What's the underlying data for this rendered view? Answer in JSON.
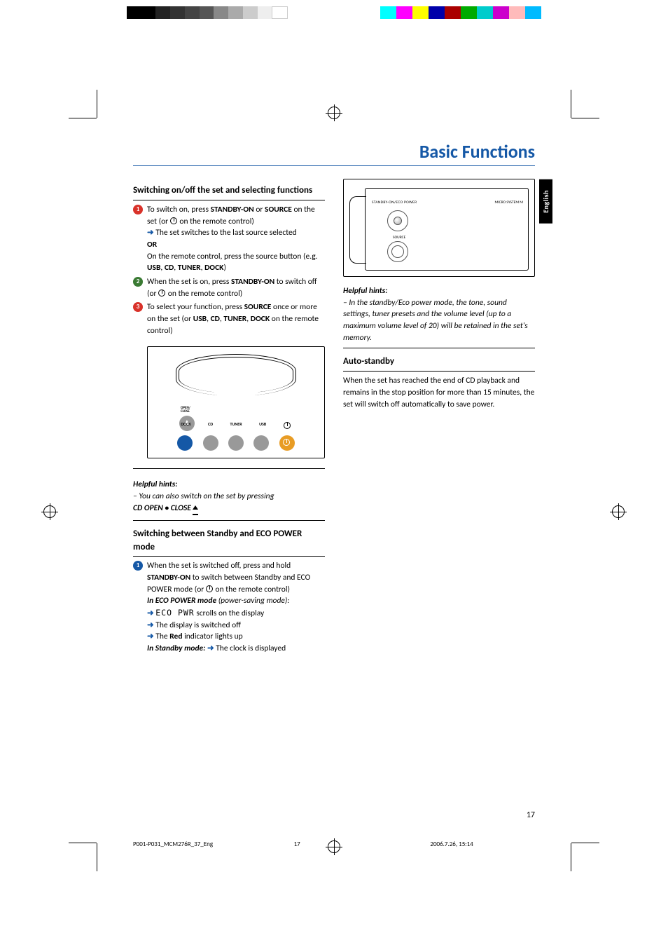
{
  "title": "Basic Functions",
  "lang_tab": "English",
  "page_number": "17",
  "footer": {
    "file": "P001-P031_MCM276R_37_Eng",
    "page": "17",
    "timestamp": "2006.7.26, 15:14"
  },
  "colors": {
    "accent": "#1558a6",
    "numdot_default": "#d9322a"
  },
  "left_col": {
    "s1_head": "Switching on/off the set and selecting functions",
    "step1_a": "To switch on, press ",
    "step1_b": "STANDBY-ON",
    "step1_c": " or ",
    "step1_d": "SOURCE",
    "step1_e": " on the set (or ",
    "step1_f": " on the remote control)",
    "step1_arrow": "➜",
    "step1_res": " The set switches to the last source selected",
    "or": "OR",
    "step1_or_a": "On the remote control, press the source button (e.g. ",
    "step1_or_b": "USB",
    "step1_or_c": ", ",
    "step1_or_d": "CD",
    "step1_or_e": ", ",
    "step1_or_f": "TUNER",
    "step1_or_g": ",  ",
    "step1_or_h": "DOCK",
    "step1_or_i": ")",
    "step2_a": "When the set is on, press ",
    "step2_b": "STANDBY-ON",
    "step2_c": " to switch off (or ",
    "step2_d": " on the remote control)",
    "step3_a": "To select your function, press ",
    "step3_b": "SOURCE",
    "step3_c": " once or more on the set (or ",
    "step3_d": "USB",
    "step3_e": ", ",
    "step3_f": "CD",
    "step3_g": ", ",
    "step3_h": "TUNER",
    "step3_i": ", ",
    "step3_j": "DOCK",
    "step3_k": " on the remote control)",
    "diagram1_labels": [
      "DOCK",
      "CD",
      "TUNER",
      "USB"
    ],
    "diagram1_openclose": "OPEN/\nCLOSE",
    "hint_head": "Helpful hints:",
    "hint1_a": "–  You can also switch on the set by pressing ",
    "hint1_b": "CD OPEN • CLOSE ",
    "s2_head": "Switching between Standby and ECO POWER mode",
    "s2_step1_a": "When the set is switched off, press and hold ",
    "s2_step1_b": "STANDBY-ON",
    "s2_step1_c": " to switch between Standby and ECO POWER mode (or ",
    "s2_step1_d": " on the remote control)",
    "eco_head_a": "In ECO POWER mode ",
    "eco_head_b": "(power-saving mode):",
    "eco_b1_arrow": "➜",
    "eco_b1_lcd": "ECO PWR",
    "eco_b1_txt": "  scrolls on the display",
    "eco_b2_arrow": "➜",
    "eco_b2_txt": " The display is switched off",
    "eco_b3_arrow": "➜",
    "eco_b3_a": " The ",
    "eco_b3_b": "Red",
    "eco_b3_c": " indicator lights up",
    "sb_head": "In Standby mode: ",
    "sb_arrow": "➜",
    "sb_txt": "  The clock is displayed"
  },
  "right_col": {
    "d2_label_top": "STANDBY-ON/ECO POWER",
    "d2_label_model": "MICRO SYSTEM M",
    "d2_label_source": "SOURCE",
    "hint_head": "Helpful hints:",
    "hint_body": "–  In the standby/Eco power mode, the tone, sound settings, tuner presets and the volume level (up to a maximum volume level of 20) will be retained in the set's memory.",
    "s3_head": "Auto-standby",
    "s3_body": "When the set has reached the end of CD playback and remains in the stop position for more than 15 minutes, the set will switch off automatically to save power."
  }
}
